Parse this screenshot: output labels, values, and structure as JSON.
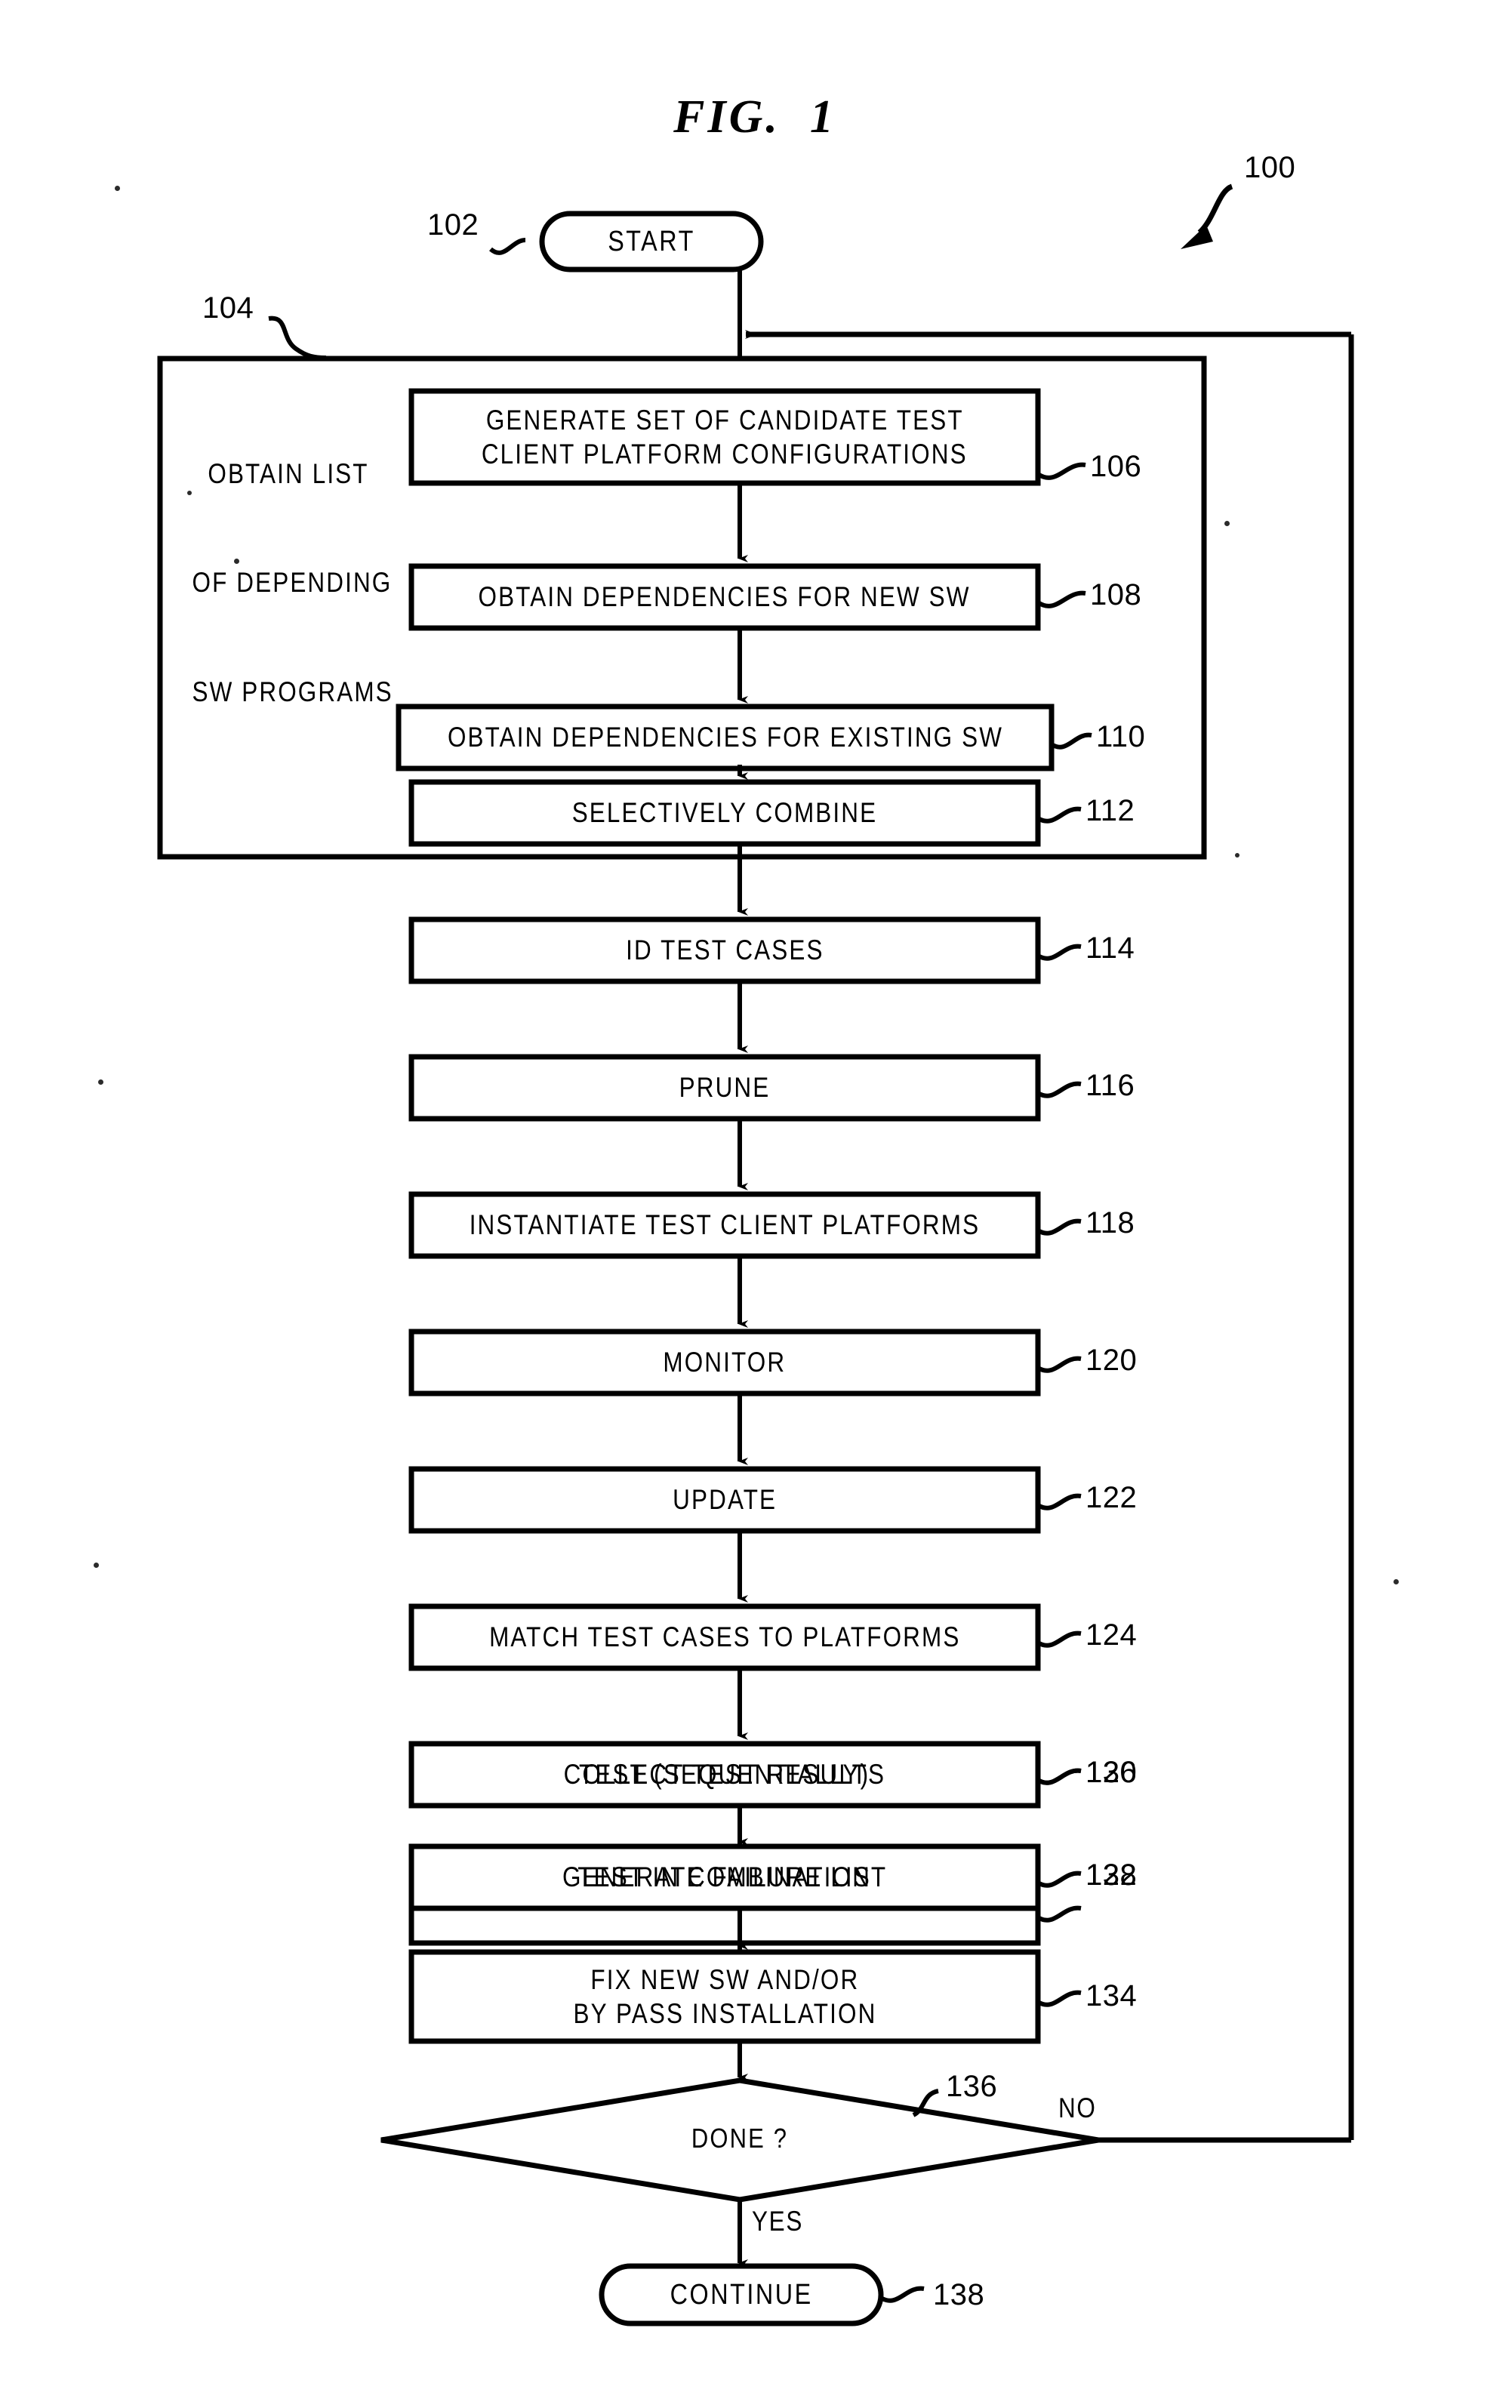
{
  "figure": {
    "title": "FIG.  1",
    "overall_ref": "100"
  },
  "terminals": {
    "start": {
      "label": "START",
      "ref": "102"
    },
    "continue": {
      "label": "CONTINUE",
      "ref": "138"
    }
  },
  "group": {
    "ref": "104",
    "label_lines": [
      "OBTAIN LIST",
      "OF DEPENDING",
      "SW PROGRAMS"
    ]
  },
  "steps": [
    {
      "ref": "106",
      "lines": [
        "GENERATE SET OF CANDIDATE TEST",
        "CLIENT PLATFORM CONFIGURATIONS"
      ]
    },
    {
      "ref": "108",
      "lines": [
        "OBTAIN DEPENDENCIES FOR NEW SW"
      ]
    },
    {
      "ref": "110",
      "lines": [
        "OBTAIN DEPENDENCIES FOR EXISTING SW"
      ]
    },
    {
      "ref": "112",
      "lines": [
        "SELECTIVELY COMBINE"
      ]
    },
    {
      "ref": "114",
      "lines": [
        "ID TEST CASES"
      ]
    },
    {
      "ref": "116",
      "lines": [
        "PRUNE"
      ]
    },
    {
      "ref": "118",
      "lines": [
        "INSTANTIATE TEST CLIENT PLATFORMS"
      ]
    },
    {
      "ref": "120",
      "lines": [
        "MONITOR"
      ]
    },
    {
      "ref": "122",
      "lines": [
        "UPDATE"
      ]
    },
    {
      "ref": "124",
      "lines": [
        "MATCH TEST CASES TO PLATFORMS"
      ]
    },
    {
      "ref": "126",
      "lines": [
        "TEST (SEQUENTIALLY)"
      ]
    },
    {
      "ref": "128",
      "lines": [
        "TEST IN COMBINATION"
      ]
    },
    {
      "ref": "130",
      "lines": [
        "COLLECT TEST RESULTS"
      ]
    },
    {
      "ref": "132",
      "lines": [
        "GENERATE FAILURE LIST"
      ]
    },
    {
      "ref": "134",
      "lines": [
        "FIX NEW SW AND/OR",
        "BY PASS INSTALLATION"
      ]
    }
  ],
  "decision": {
    "ref": "136",
    "label": "DONE ?",
    "yes_label": "YES",
    "no_label": "NO"
  },
  "colors": {
    "ink": "#000000",
    "paper": "#ffffff"
  }
}
